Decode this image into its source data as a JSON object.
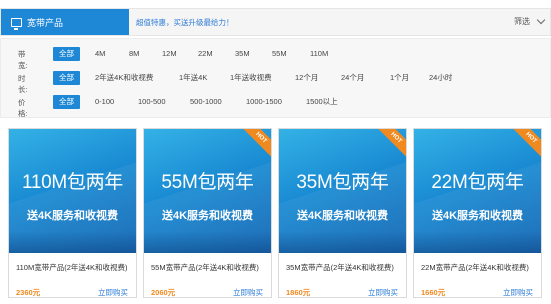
{
  "header": {
    "title": "宽带产品",
    "tip": "超值特惠，买送升级最给力！",
    "filter_label": "筛选"
  },
  "filters": {
    "rows": [
      {
        "label": "带宽:",
        "options": [
          "全部",
          "4M",
          "8M",
          "12M",
          "22M",
          "35M",
          "55M",
          "110M"
        ],
        "selected": "全部"
      },
      {
        "label": "时长:",
        "options": [
          "全部",
          "2年送4K和收视费",
          "1年送4K",
          "1年送收视费",
          "12个月",
          "24个月",
          "1个月",
          "24小时"
        ],
        "selected": "全部"
      },
      {
        "label": "价格:",
        "options": [
          "全部",
          "0-100",
          "100-500",
          "500-1000",
          "1000-1500",
          "1500以上"
        ],
        "selected": "全部"
      }
    ]
  },
  "products": [
    {
      "banner_title": "110M包两年",
      "banner_sub": "送4K服务和收视费",
      "hot": false,
      "name": "110M宽带产品(2年送4K和收视费)",
      "price": "2360元",
      "buy_label": "立即购买"
    },
    {
      "banner_title": "55M包两年",
      "banner_sub": "送4K服务和收视费",
      "hot": true,
      "hot_label": "HOT",
      "name": "55M宽带产品(2年送4K和收视费)",
      "price": "2060元",
      "buy_label": "立即购买"
    },
    {
      "banner_title": "35M包两年",
      "banner_sub": "送4K服务和收视费",
      "hot": true,
      "hot_label": "HOT",
      "name": "35M宽带产品(2年送4K和收视费)",
      "price": "1860元",
      "buy_label": "立即购买"
    },
    {
      "banner_title": "22M包两年",
      "banner_sub": "送4K服务和收视费",
      "hot": true,
      "hot_label": "HOT",
      "name": "22M宽带产品(2年送4K和收视费)",
      "price": "1660元",
      "buy_label": "立即购买"
    }
  ],
  "colors": {
    "accent": "#1e88d7",
    "price": "#f08a20",
    "hot_badge": "#f08a20",
    "link": "#2b7bd6"
  },
  "icons": {
    "header": "monitor-icon",
    "filter": "chevron-down-icon"
  }
}
